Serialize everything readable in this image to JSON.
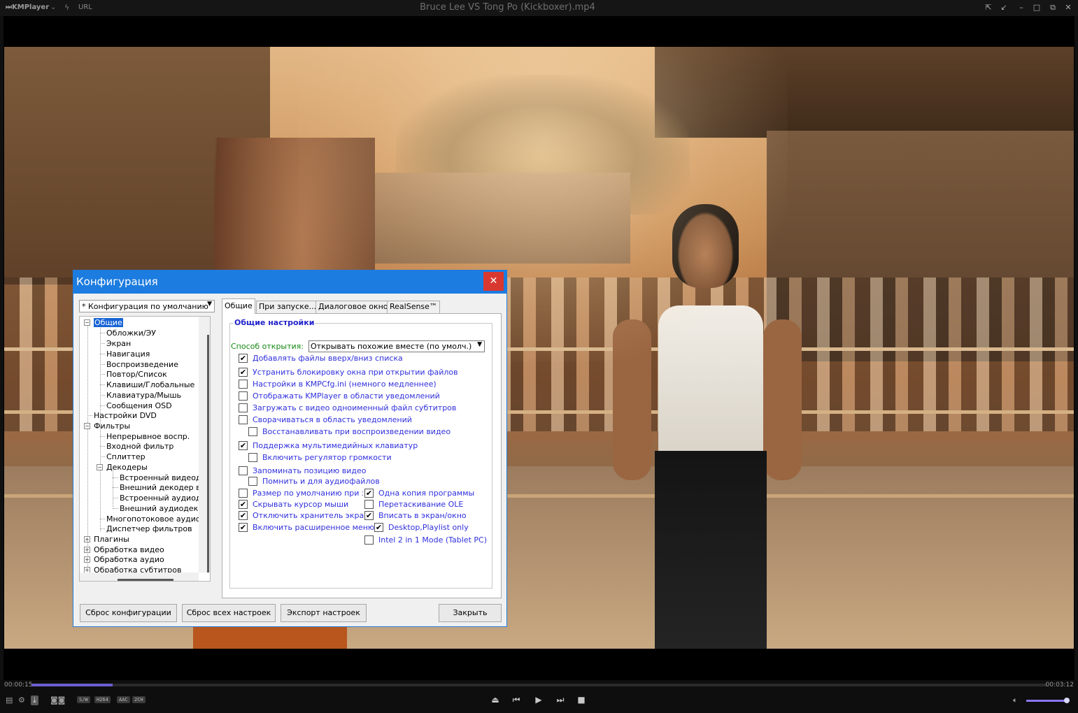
{
  "app": {
    "logo": "KMPlayer",
    "logo_arrow": "⌄",
    "url_label": "URL",
    "window_title": "Bruce Lee VS Tong Po (Kickboxer).mp4"
  },
  "playback": {
    "elapsed": "00:00:15",
    "duration": "00:03:12",
    "progress_fraction": 0.08,
    "volume_fraction": 0.95,
    "badges": [
      "S/W",
      "H264",
      "AAC",
      "2CH"
    ]
  },
  "colors": {
    "accent": "#6b5fd0",
    "dialog_title": "#1c7ce0",
    "close_button": "#d93830",
    "option_text": "#3030dd",
    "label_green": "#138a13"
  },
  "dialog": {
    "title": "Конфигурация",
    "close_glyph": "✕",
    "profile": "* Конфигурация по умолчанию",
    "tree": [
      "Общие",
      "Обложки/ЭУ",
      "Экран",
      "Навигация",
      "Воспроизведение",
      "Повтор/Список",
      "Клавиши/Глобальные",
      "Клавиатура/Мышь",
      "Сообщения OSD",
      "Настройки DVD",
      "Фильтры",
      "Непрерывное воспр.",
      "Входной фильтр",
      "Сплиттер",
      "Декодеры",
      "Встроенный видеоде",
      "Внешний декодер ви",
      "Встроенный аудиодек",
      "Внешний аудиодекод",
      "Многопотоковое аудио",
      "Диспетчер фильтров",
      "Плагины",
      "Обработка видео",
      "Обработка аудио",
      "Обработка субтитров"
    ],
    "tabs": [
      "Общие",
      "При запуске...",
      "Диалоговое окно",
      "RealSense™"
    ],
    "group_title": "Общие настройки",
    "open_mode_label": "Способ открытия:",
    "open_mode_value": "Открывать похожие вместе (по умолч.)",
    "options": [
      {
        "label": "Добавлять файлы вверх/вниз списка",
        "checked": true
      },
      {
        "label": "Устранить блокировку окна при открытии файлов",
        "checked": true
      },
      {
        "label": "Настройки в KMPCfg.ini (немного медленнее)",
        "checked": false
      },
      {
        "label": "Отображать KMPlayer в области уведомлений",
        "checked": false
      },
      {
        "label": "Загружать с видео одноименный файл субтитров",
        "checked": false
      },
      {
        "label": "Сворачиваться в область уведомлений",
        "checked": false
      },
      {
        "label": "Восстанавливать при воспроизведении видео",
        "checked": false
      },
      {
        "label": "Поддержка мультимедийных клавиатур",
        "checked": true
      },
      {
        "label": "Включить регулятор громкости",
        "checked": false
      },
      {
        "label": "Запоминать позицию видео",
        "checked": false
      },
      {
        "label": "Помнить и для аудиофайлов",
        "checked": false
      },
      {
        "label": "Размер по умолчанию при запуске",
        "checked": false
      },
      {
        "label": "Скрывать курсор мыши",
        "checked": true
      },
      {
        "label": "Отключить хранитель экрана",
        "checked": true
      },
      {
        "label": "Включить расширенное меню",
        "checked": true
      },
      {
        "label": "Одна копия программы",
        "checked": true
      },
      {
        "label": "Перетаскивание OLE",
        "checked": false
      },
      {
        "label": "Вписать в экран/окно",
        "checked": true
      },
      {
        "label": "Desktop,Playlist only",
        "checked": true
      },
      {
        "label": "Intel 2 in 1 Mode (Tablet PC)",
        "checked": false
      }
    ],
    "buttons": {
      "reset_config": "Сброс конфигурации",
      "reset_all": "Сброс всех настроек",
      "export": "Экспорт настроек",
      "close": "Закрыть"
    }
  }
}
